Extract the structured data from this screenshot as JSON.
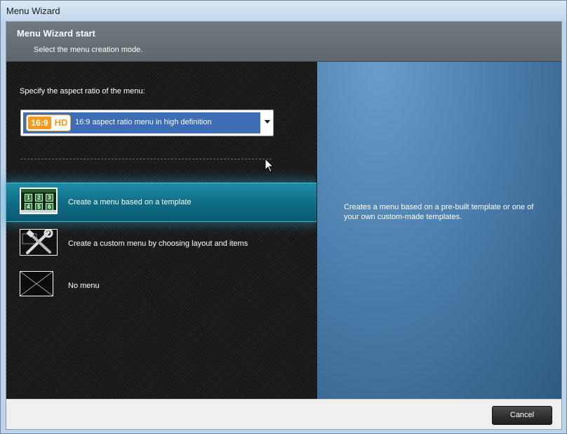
{
  "window": {
    "title": "Menu Wizard"
  },
  "header": {
    "title": "Menu Wizard start",
    "subtitle": "Select the menu creation mode."
  },
  "aspect": {
    "label": "Specify the aspect ratio of the menu:",
    "selected_text": "16:9 aspect ratio menu in high definition",
    "badge_ratio": "16:9",
    "badge_hd": "HD"
  },
  "options": [
    {
      "label": "Create a menu based on a template",
      "icon": "template-thumbnail-icon",
      "selected": true
    },
    {
      "label": "Create a custom menu by choosing layout and items",
      "icon": "tools-icon",
      "selected": false
    },
    {
      "label": "No menu",
      "icon": "empty-frame-icon",
      "selected": false
    }
  ],
  "template_thumb": {
    "cells": [
      "1",
      "2",
      "3",
      "4",
      "5",
      "6"
    ]
  },
  "description": "Creates a menu based on a pre-built template or one of your own custom-made templates.",
  "footer": {
    "cancel_label": "Cancel"
  },
  "colors": {
    "selection": "#0f6e86",
    "combo_highlight": "#3d6db4",
    "badge_orange": "#f29b1e",
    "right_panel": "#4c7fad"
  }
}
